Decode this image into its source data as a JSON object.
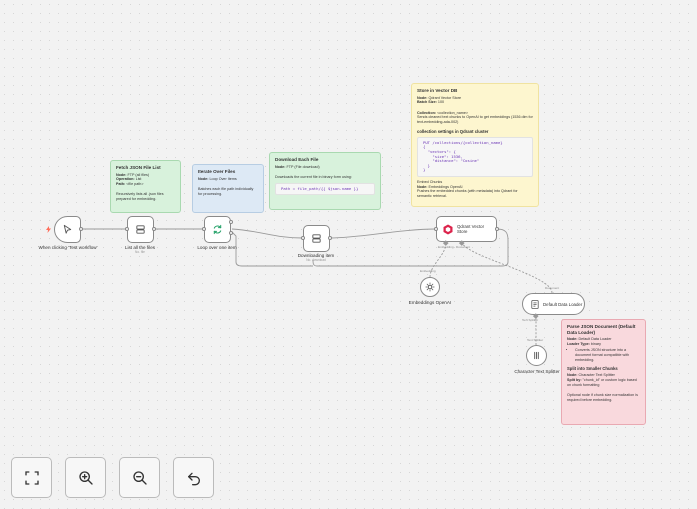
{
  "notes": {
    "fetch": {
      "title": "Fetch JSON File List",
      "node_key": "Node:",
      "node_val": "FTP (all files)",
      "op_key": "Operation:",
      "op_val": "List",
      "path_key": "Path:",
      "path_val": "<file path>",
      "desc": "Recursively lists all .json files prepared for embedding."
    },
    "iterate": {
      "title": "Iterate Over Files",
      "node_key": "Node:",
      "node_val": "Loop Over Items",
      "desc": "Batches each file path individually for processing."
    },
    "download": {
      "title": "Download Each File",
      "node_key": "Node:",
      "node_val": "FTP (File download)",
      "desc": "Downloads the current file in binary form using:",
      "code": "Path = file_path/{{ $json.name }}"
    },
    "store": {
      "title": "Store in Vector DB",
      "node_key": "Node:",
      "node_val": "Qdrant Vector Store",
      "batch_key": "Batch Size:",
      "batch_val": "100",
      "collection_key": "Collection:",
      "collection_val": "<collection_name>",
      "collection_desc": "Sends cleaned text chunks to OpenAI to get embeddings (1536 dim for text-embedding-ada-002)",
      "settings_title": "collection settings in Qdrant cluster",
      "code": "PUT /collections/{collection_name}\n{\n  \"vectors\": {\n    \"size\": 1536,\n    \"distance\": \"Cosine\"\n  }\n}",
      "embed_title": "Embed Chunks",
      "embed_node_key": "Node:",
      "embed_node_val": "Embeddings OpenAI",
      "embed_desc": "Pushes the embedded chunks (with metadata) into Qdrant for semantic retrieval."
    },
    "parse": {
      "title": "Parse JSON Document (Default Data Loader)",
      "node_key": "Node:",
      "node_val": "Default Data Loader",
      "loader_key": "Loader Type:",
      "loader_val": "binary",
      "bullet": "Converts JSON structure into a document format compatible with embedding.",
      "split_title": "Split into Smaller Chunks",
      "split_node_key": "Node:",
      "split_node_val": "Character Text Splitter",
      "split_by_key": "Split by:",
      "split_by_val": "\"chunk_id\" or custom logic based on chunk formatting",
      "optional": "Optional node if chunk size normalization is required before embedding."
    }
  },
  "nodes": {
    "trigger": {
      "label": "When clicking 'Test workflow'"
    },
    "list": {
      "label": "List all the files",
      "sub": "No. file"
    },
    "loop": {
      "label": "Loop over one item"
    },
    "download": {
      "label": "Downloading item",
      "sub": "No. download"
    },
    "qdrant": {
      "label": "Qdrant Vector Store",
      "embedding_tag": "Embedding",
      "document_tag": "Document"
    },
    "embeddings": {
      "label": "Embeddings OpenAI",
      "tag": "Embedding"
    },
    "loader": {
      "label": "Default Data Loader",
      "document_tag": "Document",
      "splitter_tag": "Text Splitter"
    },
    "splitter": {
      "label": "Character Text Splitter",
      "tag": "Text Splitter"
    }
  },
  "controls": {
    "fit": "fit-view",
    "zoom_in": "zoom-in",
    "zoom_out": "zoom-out",
    "undo": "undo"
  }
}
